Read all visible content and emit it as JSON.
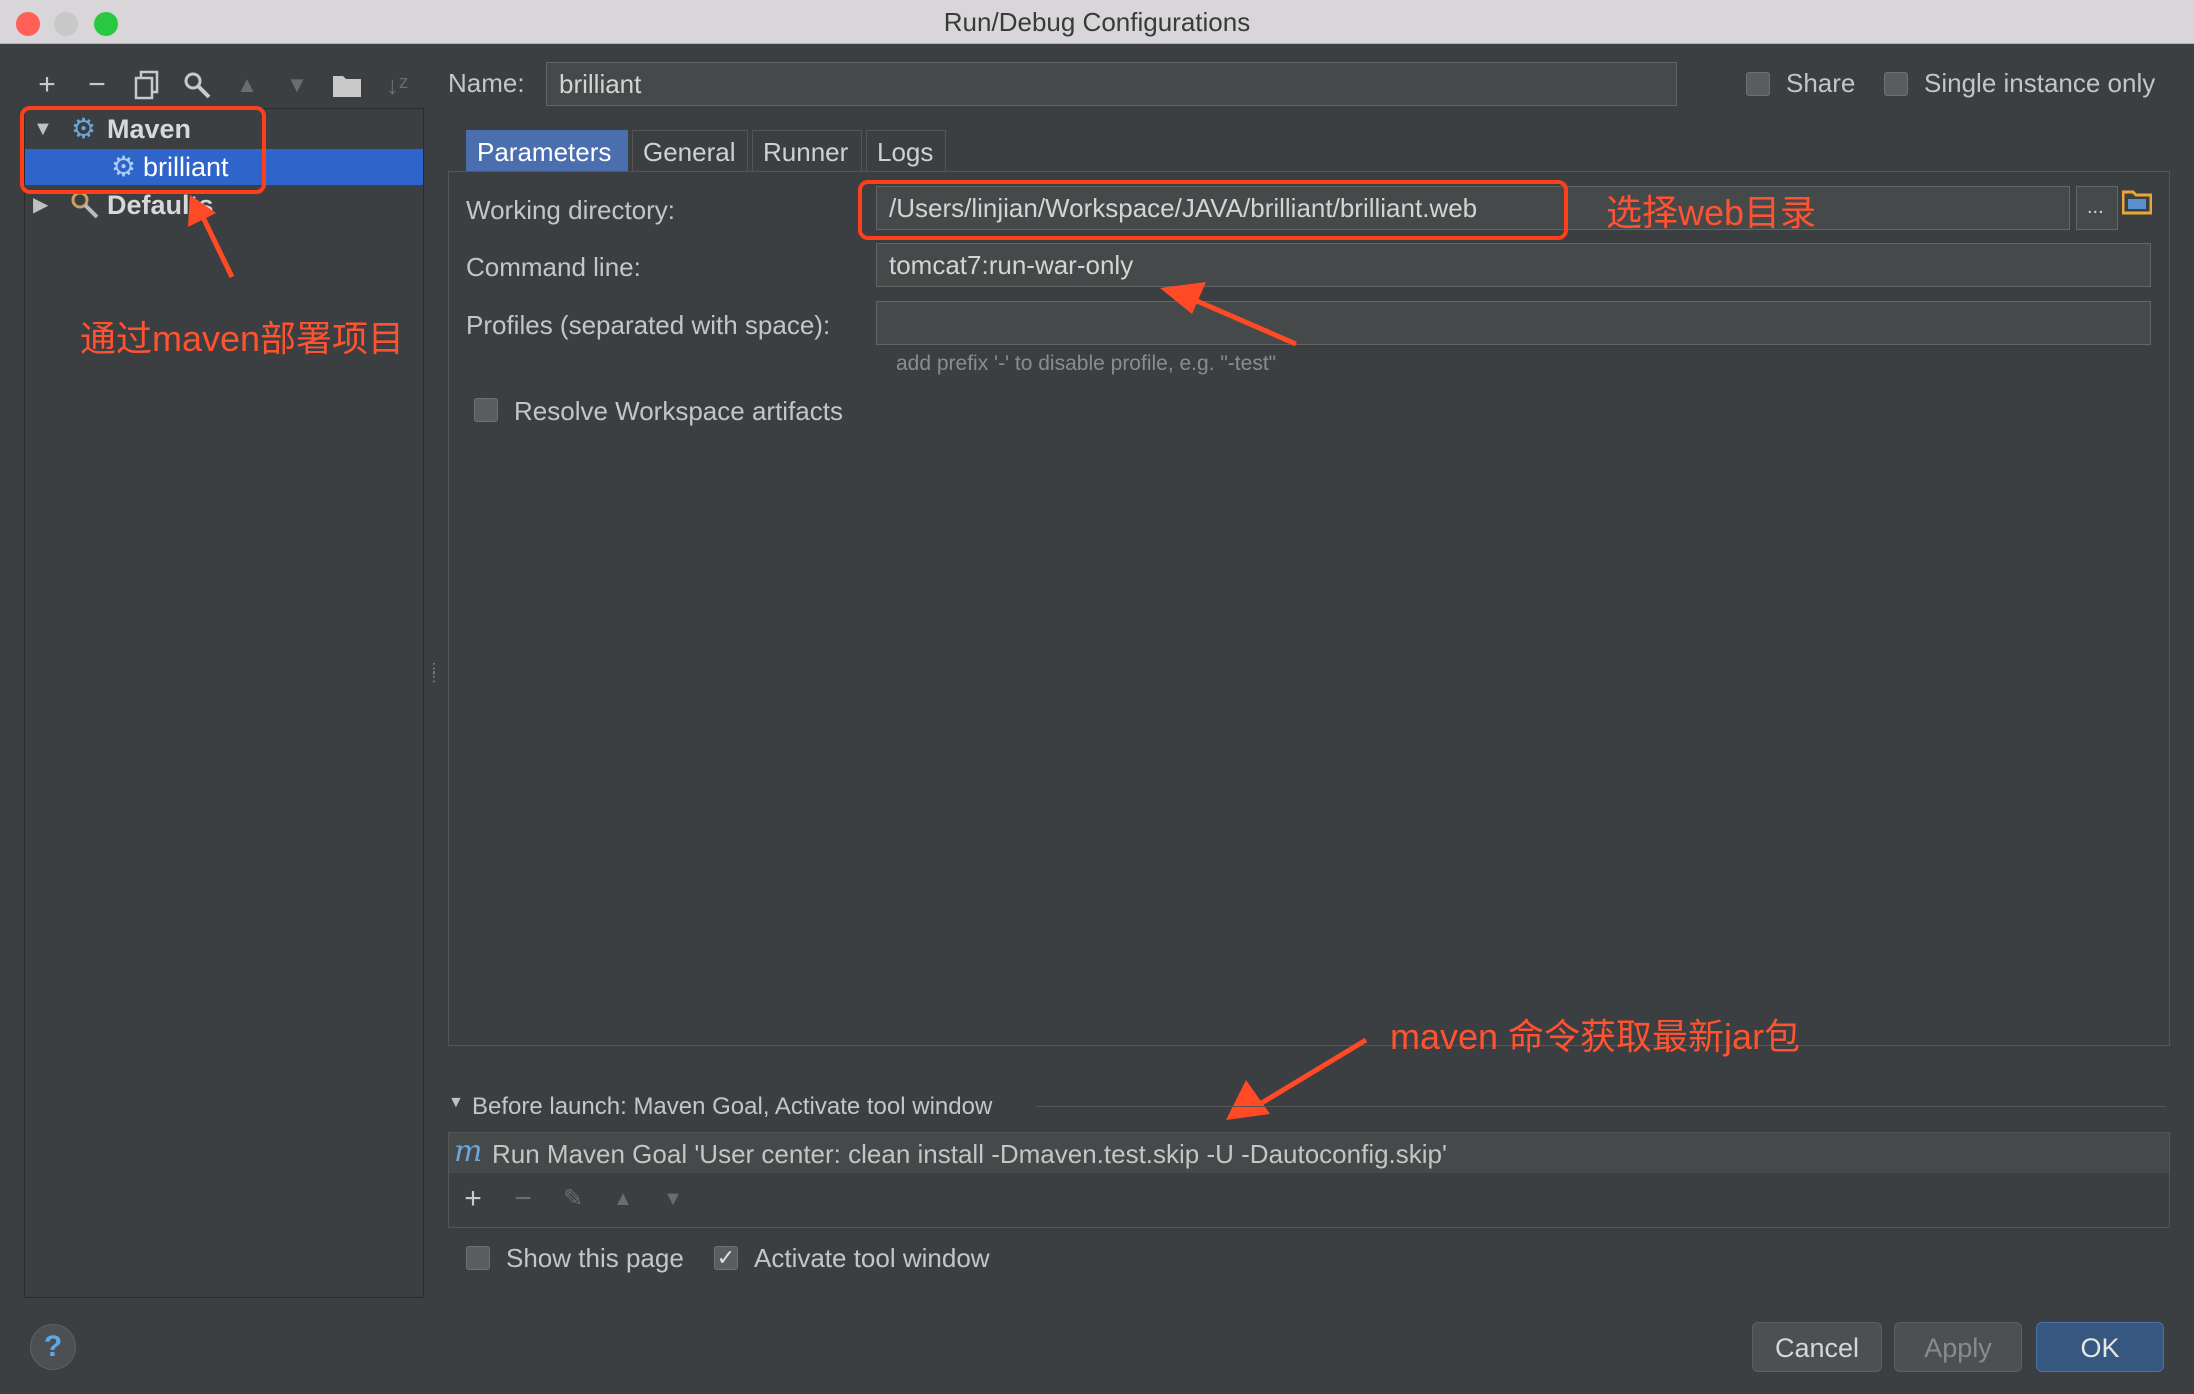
{
  "window": {
    "title": "Run/Debug Configurations",
    "traffic_lights": {
      "close": "#ff5f57",
      "minimize": "#c8c8c8",
      "maximize": "#28c840"
    }
  },
  "toolbar": {
    "icons": [
      "add-icon",
      "remove-icon",
      "copy-icon",
      "edit-defaults-icon",
      "move-up-icon",
      "move-down-icon",
      "folder-icon",
      "sort-icon"
    ]
  },
  "tree": {
    "items": [
      {
        "label": "Maven",
        "icon": "gear-icon",
        "expanded": true
      },
      {
        "label": "brilliant",
        "icon": "gear-icon",
        "selected": true
      },
      {
        "label": "Defaults",
        "icon": "wrench-icon",
        "expanded": false
      }
    ]
  },
  "header": {
    "name_label": "Name:",
    "name_value": "brilliant",
    "share_label": "Share",
    "single_instance_label": "Single instance only"
  },
  "tabs": [
    "Parameters",
    "General",
    "Runner",
    "Logs"
  ],
  "parameters": {
    "working_dir_label": "Working directory:",
    "working_dir_value": "/Users/linjian/Workspace/JAVA/brilliant/brilliant.web",
    "browse_label": "...",
    "command_line_label": "Command line:",
    "command_line_value": "tomcat7:run-war-only",
    "profiles_label": "Profiles (separated with space):",
    "profiles_value": "",
    "profiles_hint": "add prefix '-' to disable profile, e.g. \"-test\"",
    "resolve_label": "Resolve Workspace artifacts"
  },
  "before_launch": {
    "header": "Before launch: Maven Goal, Activate tool window",
    "task_icon": "m",
    "task": "Run Maven Goal 'User center: clean install -Dmaven.test.skip -U -Dautoconfig.skip'",
    "toolbar_icons": [
      "add-icon",
      "remove-icon",
      "edit-icon",
      "move-up-icon",
      "move-down-icon"
    ]
  },
  "footer": {
    "show_page_label": "Show this page",
    "show_page_checked": false,
    "activate_label": "Activate tool window",
    "activate_checked": true,
    "help": "?",
    "cancel": "Cancel",
    "apply": "Apply",
    "ok": "OK"
  },
  "annotations": {
    "maven_note": "通过maven部署项目",
    "web_dir_note": "选择web目录",
    "goal_note": "maven 命令获取最新jar包"
  }
}
